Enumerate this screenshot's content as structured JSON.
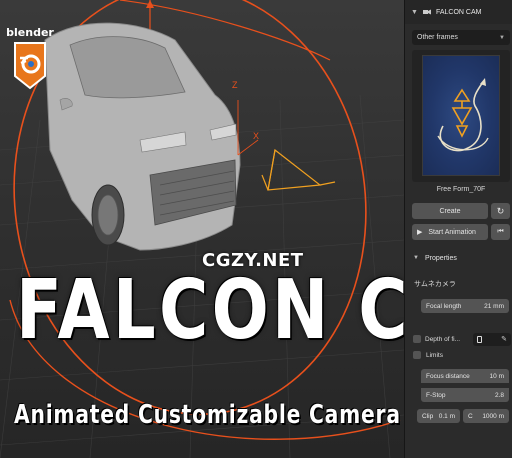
{
  "logo": {
    "text": "blender"
  },
  "watermark": "CGZY.NET",
  "overlay": {
    "title": "FALCON CAM",
    "subtitle": "Animated Customizable Camera work"
  },
  "viewport": {
    "axis_z": "Z",
    "axis_x": "X",
    "accent_color": "#e8501c"
  },
  "panel": {
    "header_title": "FALCON CAM",
    "frames_dropdown": "Other frames",
    "preset_label": "Free Form_70F",
    "create_label": "Create",
    "start_animation_label": "Start Animation",
    "properties_label": "Properties",
    "camera_name": "サムネカメラ",
    "focal_length": {
      "label": "Focal length",
      "value": "21 mm"
    },
    "depth_of_field": {
      "label": "Depth of fi..."
    },
    "limits_label": "Limits",
    "focus_distance": {
      "label": "Focus distance",
      "value": "10 m"
    },
    "fstop": {
      "label": "F-Stop",
      "value": "2.8"
    },
    "clip_start": {
      "label": "Clip",
      "value": "0.1 m"
    },
    "clip_end": {
      "label": "C",
      "value": "1000 m"
    }
  }
}
